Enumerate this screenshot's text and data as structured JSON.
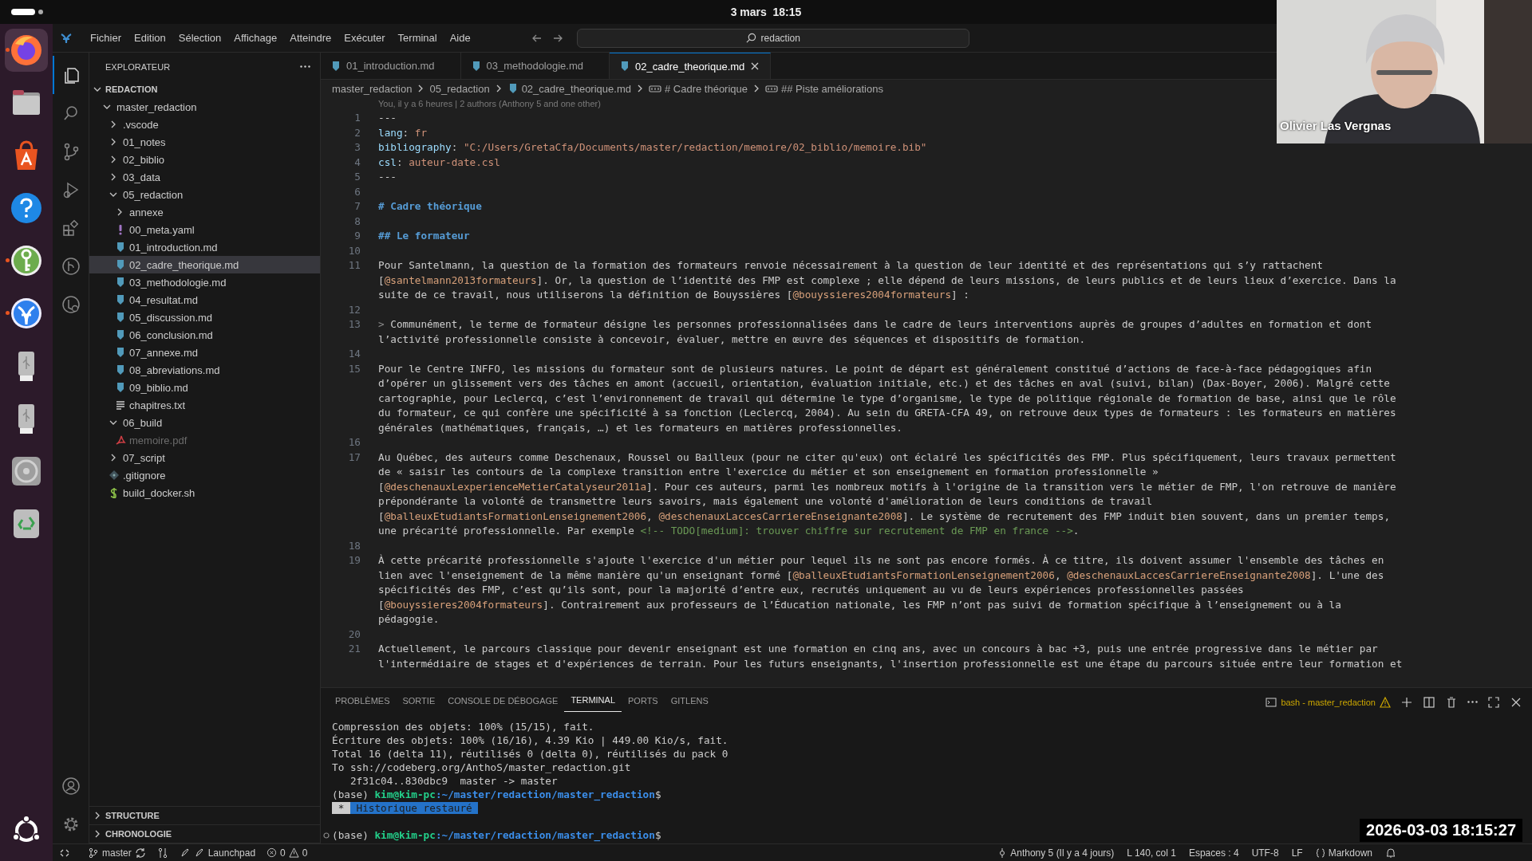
{
  "top_bar": {
    "clock": "3 mars  18:15"
  },
  "dock": [
    {
      "kind": "firefox",
      "running": true,
      "focused": true
    },
    {
      "kind": "files",
      "running": false,
      "focused": false
    },
    {
      "kind": "app-center",
      "running": false,
      "focused": false
    },
    {
      "kind": "help",
      "running": false,
      "focused": false
    },
    {
      "kind": "keepass",
      "running": true,
      "focused": false
    },
    {
      "kind": "vscodium",
      "running": true,
      "focused": false
    },
    {
      "kind": "usb",
      "running": false,
      "focused": false
    },
    {
      "kind": "usb",
      "running": false,
      "focused": false
    },
    {
      "kind": "disc",
      "running": false,
      "focused": false
    },
    {
      "kind": "trash",
      "running": false,
      "focused": false
    }
  ],
  "menu": [
    "Fichier",
    "Edition",
    "Sélection",
    "Affichage",
    "Atteindre",
    "Exécuter",
    "Terminal",
    "Aide"
  ],
  "command_center": {
    "text": "redaction"
  },
  "activity_bar": [
    {
      "kind": "explorer",
      "selected": true
    },
    {
      "kind": "search",
      "selected": false
    },
    {
      "kind": "source-control",
      "selected": false
    },
    {
      "kind": "run",
      "selected": false
    },
    {
      "kind": "extensions",
      "selected": false
    },
    {
      "kind": "gitlens",
      "selected": false
    },
    {
      "kind": "remote",
      "selected": false
    }
  ],
  "explorer": {
    "title": "EXPLORATEUR",
    "section": {
      "label": "REDACTION",
      "expanded": true
    },
    "tree": [
      {
        "kind": "folder",
        "name": "master_redaction",
        "expanded": true,
        "selected": false,
        "ignored": false,
        "children": [
          {
            "kind": "folder",
            "name": ".vscode",
            "expanded": false,
            "selected": false,
            "ignored": false
          },
          {
            "kind": "folder",
            "name": "01_notes",
            "expanded": false,
            "selected": false,
            "ignored": false
          },
          {
            "kind": "folder",
            "name": "02_biblio",
            "expanded": false,
            "selected": false,
            "ignored": false
          },
          {
            "kind": "folder",
            "name": "03_data",
            "expanded": false,
            "selected": false,
            "ignored": false
          },
          {
            "kind": "folder",
            "name": "05_redaction",
            "expanded": true,
            "selected": false,
            "ignored": false,
            "children": [
              {
                "kind": "folder",
                "name": "annexe",
                "expanded": false,
                "selected": false,
                "ignored": false
              },
              {
                "kind": "yaml",
                "name": "00_meta.yaml",
                "selected": false,
                "ignored": false
              },
              {
                "kind": "md",
                "name": "01_introduction.md",
                "selected": false,
                "ignored": false
              },
              {
                "kind": "md",
                "name": "02_cadre_theorique.md",
                "selected": true,
                "ignored": false
              },
              {
                "kind": "md",
                "name": "03_methodologie.md",
                "selected": false,
                "ignored": false
              },
              {
                "kind": "md",
                "name": "04_resultat.md",
                "selected": false,
                "ignored": false
              },
              {
                "kind": "md",
                "name": "05_discussion.md",
                "selected": false,
                "ignored": false
              },
              {
                "kind": "md",
                "name": "06_conclusion.md",
                "selected": false,
                "ignored": false
              },
              {
                "kind": "md",
                "name": "07_annexe.md",
                "selected": false,
                "ignored": false
              },
              {
                "kind": "md",
                "name": "08_abreviations.md",
                "selected": false,
                "ignored": false
              },
              {
                "kind": "md",
                "name": "09_biblio.md",
                "selected": false,
                "ignored": false
              },
              {
                "kind": "txt",
                "name": "chapitres.txt",
                "selected": false,
                "ignored": false
              }
            ]
          },
          {
            "kind": "folder",
            "name": "06_build",
            "expanded": true,
            "selected": false,
            "ignored": false,
            "children": [
              {
                "kind": "pdf",
                "name": "memoire.pdf",
                "selected": false,
                "ignored": true
              }
            ]
          },
          {
            "kind": "folder",
            "name": "07_script",
            "expanded": false,
            "selected": false,
            "ignored": false
          },
          {
            "kind": "git",
            "name": ".gitignore",
            "selected": false,
            "ignored": false
          },
          {
            "kind": "sh",
            "name": "build_docker.sh",
            "selected": false,
            "ignored": false
          }
        ]
      }
    ],
    "bottom_sections": [
      {
        "label": "STRUCTURE",
        "expanded": false
      },
      {
        "label": "CHRONOLOGIE",
        "expanded": false
      }
    ]
  },
  "tabs": [
    {
      "label": "01_introduction.md",
      "selected": false
    },
    {
      "label": "03_methodologie.md",
      "selected": false
    },
    {
      "label": "02_cadre_theorique.md",
      "selected": true
    }
  ],
  "breadcrumb": [
    {
      "kind": "folder",
      "text": "master_redaction"
    },
    {
      "kind": "folder",
      "text": "05_redaction"
    },
    {
      "kind": "file",
      "text": "02_cadre_theorique.md"
    },
    {
      "kind": "heading",
      "text": "# Cadre théorique"
    },
    {
      "kind": "heading",
      "text": "## Piste améliorations"
    }
  ],
  "editor": {
    "blame": "You, il y a 6 heures | 2 authors (Anthony 5 and one other)",
    "lines": [
      {
        "number": "1",
        "rows": [
          "---"
        ]
      },
      {
        "number": "2",
        "rows": [
          [
            {
              "kind": "key",
              "text": "lang"
            },
            {
              "kind": "text",
              "text": ": "
            },
            {
              "kind": "string",
              "text": "fr"
            }
          ]
        ]
      },
      {
        "number": "3",
        "rows": [
          [
            {
              "kind": "key",
              "text": "bibliography"
            },
            {
              "kind": "text",
              "text": ": "
            },
            {
              "kind": "string",
              "text": "\"C:/Users/GretaCfa/Documents/master/redaction/memoire/02_biblio/memoire.bib\""
            }
          ]
        ]
      },
      {
        "number": "4",
        "rows": [
          [
            {
              "kind": "key",
              "text": "csl"
            },
            {
              "kind": "text",
              "text": ": "
            },
            {
              "kind": "string",
              "text": "auteur-date.csl"
            }
          ]
        ]
      },
      {
        "number": "5",
        "rows": [
          "---"
        ]
      },
      {
        "number": "6"
      },
      {
        "number": "7",
        "rows": [
          [
            {
              "kind": "heading",
              "text": "# Cadre théorique"
            }
          ]
        ]
      },
      {
        "number": "8"
      },
      {
        "number": "9",
        "rows": [
          [
            {
              "kind": "heading",
              "text": "## Le formateur"
            }
          ]
        ]
      },
      {
        "number": "10"
      },
      {
        "number": "11",
        "rows": [
          "Pour Santelmann, la question de la formation des formateurs renvoie nécessairement à la question de leur identité et des représentations qui s’y rattachent",
          [
            {
              "kind": "text",
              "text": "["
            },
            {
              "kind": "cite",
              "text": "@santelmann2013formateurs"
            },
            {
              "kind": "text",
              "text": "]. Or, la question de l’identité des FMP est complexe ; elle dépend de leurs missions, de leurs publics et de leurs lieux d’exercice. Dans la"
            }
          ],
          [
            {
              "kind": "text",
              "text": "suite de ce travail, nous utiliserons la définition de Bouyssières ["
            },
            {
              "kind": "cite",
              "text": "@bouyssieres2004formateurs"
            },
            {
              "kind": "text",
              "text": "] :"
            }
          ]
        ]
      },
      {
        "number": "12"
      },
      {
        "number": "13",
        "rows": [
          [
            {
              "kind": "quote",
              "text": ">"
            },
            {
              "kind": "text",
              "text": " Communément, le terme de formateur désigne les personnes professionnalisées dans le cadre de leurs interventions auprès de groupes d’adultes en formation et dont"
            }
          ],
          "l’activité professionnelle consiste à concevoir, évaluer, mettre en œuvre des séquences et dispositifs de formation."
        ]
      },
      {
        "number": "14"
      },
      {
        "number": "15",
        "rows": [
          "Pour le Centre INFFO, les missions du formateur sont de plusieurs natures. Le point de départ est généralement constitué d’actions de face-à-face pédagogiques afin",
          "d’opérer un glissement vers des tâches en amont (accueil, orientation, évaluation initiale, etc.) et des tâches en aval (suivi, bilan) (Dax-Boyer, 2006). Malgré cette",
          "cartographie, pour Leclercq, c’est l’environnement de travail qui détermine le type d’organisme, le type de politique régionale de formation de base, ainsi que le rôle",
          "du formateur, ce qui confère une spécificité à sa fonction (Leclercq, 2004). Au sein du GRETA-CFA 49, on retrouve deux types de formateurs : les formateurs en matières",
          "générales (mathématiques, français, …) et les formateurs en matières professionnelles."
        ]
      },
      {
        "number": "16"
      },
      {
        "number": "17",
        "rows": [
          "Au Québec, des auteurs comme Deschenaux, Roussel ou Bailleux (pour ne citer qu'eux) ont éclairé les spécificités des FMP. Plus spécifiquement, leurs travaux permettent",
          "de « saisir les contours de la complexe transition entre l'exercice du métier et son enseignement en formation professionnelle »",
          [
            {
              "kind": "text",
              "text": "["
            },
            {
              "kind": "cite",
              "text": "@deschenauxLexperienceMetierCatalyseur2011a"
            },
            {
              "kind": "text",
              "text": "]. Pour ces auteurs, parmi les nombreux motifs à l'origine de la transition vers le métier de FMP, l'on retrouve de manière"
            }
          ],
          "prépondérante la volonté de transmettre leurs savoirs, mais également une volonté d'amélioration de leurs conditions de travail",
          [
            {
              "kind": "text",
              "text": "["
            },
            {
              "kind": "cite",
              "text": "@balleuxEtudiantsFormationLenseignement2006"
            },
            {
              "kind": "text",
              "text": ", "
            },
            {
              "kind": "cite",
              "text": "@deschenauxLaccesCarriereEnseignante2008"
            },
            {
              "kind": "text",
              "text": "]. Le système de recrutement des FMP induit bien souvent, dans un premier temps,"
            }
          ],
          [
            {
              "kind": "text",
              "text": "une précarité professionnelle. Par exemple "
            },
            {
              "kind": "comment",
              "text": "<!-- TODO[medium]: trouver chiffre sur recrutement de FMP en france -->"
            },
            {
              "kind": "text",
              "text": "."
            }
          ]
        ]
      },
      {
        "number": "18"
      },
      {
        "number": "19",
        "rows": [
          "À cette précarité professionnelle s'ajoute l'exercice d'un métier pour lequel ils ne sont pas encore formés. À ce titre, ils doivent assumer l'ensemble des tâches en",
          [
            {
              "kind": "text",
              "text": "lien avec l'enseignement de la même manière qu'un enseignant formé ["
            },
            {
              "kind": "cite",
              "text": "@balleuxEtudiantsFormationLenseignement2006"
            },
            {
              "kind": "text",
              "text": ", "
            },
            {
              "kind": "cite",
              "text": "@deschenauxLaccesCarriereEnseignante2008"
            },
            {
              "kind": "text",
              "text": "]. L'une des"
            }
          ],
          "spécificités des FMP, c’est qu’ils sont, pour la majorité d’entre eux, recrutés uniquement au vu de leurs expériences professionnelles passées",
          [
            {
              "kind": "text",
              "text": "["
            },
            {
              "kind": "cite",
              "text": "@bouyssieres2004formateurs"
            },
            {
              "kind": "text",
              "text": "]. Contrairement aux professeurs de l’Éducation nationale, les FMP n’ont pas suivi de formation spécifique à l’enseignement ou à la"
            }
          ],
          "pédagogie."
        ]
      },
      {
        "number": "20"
      },
      {
        "number": "21",
        "rows": [
          "Actuellement, le parcours classique pour devenir enseignant est une formation en cinq ans, avec un concours à bac +3, puis une entrée progressive dans le métier par",
          "l'intermédiaire de stages et d'expériences de terrain. Pour les futurs enseignants, l'insertion professionnelle est une étape du parcours située entre leur formation et"
        ]
      }
    ]
  },
  "panel": {
    "tabs": [
      {
        "label": "PROBLÈMES",
        "selected": false
      },
      {
        "label": "SORTIE",
        "selected": false
      },
      {
        "label": "CONSOLE DE DÉBOGAGE",
        "selected": false
      },
      {
        "label": "TERMINAL",
        "selected": true
      },
      {
        "label": "PORTS",
        "selected": false
      },
      {
        "label": "GITLENS",
        "selected": false
      }
    ],
    "terminal_name": "bash - master_redaction",
    "lines": [
      {
        "marker": false,
        "segments": [
          {
            "kind": "text",
            "text": "Compression des objets: 100% (15/15), fait."
          }
        ]
      },
      {
        "marker": false,
        "segments": [
          {
            "kind": "text",
            "text": "Écriture des objets: 100% (16/16), 4.39 Kio | 449.00 Kio/s, fait."
          }
        ]
      },
      {
        "marker": false,
        "segments": [
          {
            "kind": "text",
            "text": "Total 16 (delta 11), réutilisés 0 (delta 0), réutilisés du pack 0"
          }
        ]
      },
      {
        "marker": false,
        "segments": [
          {
            "kind": "text",
            "text": "To ssh://codeberg.org/AnthoS/master_redaction.git"
          }
        ]
      },
      {
        "marker": false,
        "segments": [
          {
            "kind": "text",
            "text": "   2f31c04..830dbc9  master -> master"
          }
        ]
      },
      {
        "marker": false,
        "segments": [
          {
            "kind": "text",
            "text": "(base) "
          },
          {
            "kind": "user",
            "text": "kim@kim-pc"
          },
          {
            "kind": "path",
            "text": ":~/master/redaction/master_redaction"
          },
          {
            "kind": "text",
            "text": "$"
          }
        ]
      },
      {
        "marker": false,
        "segments": [
          {
            "kind": "badge",
            "text": " * "
          },
          {
            "kind": "notice",
            "text": " Historique restauré "
          }
        ]
      },
      {
        "marker": true,
        "segments": [
          {
            "kind": "text",
            "text": "(base) "
          },
          {
            "kind": "user",
            "text": "kim@kim-pc"
          },
          {
            "kind": "path",
            "text": ":~/master/redaction/master_redaction"
          },
          {
            "kind": "text",
            "text": "$"
          }
        ]
      }
    ]
  },
  "status_bar": {
    "branch": "master",
    "launchpad": "Launchpad",
    "errors": "0",
    "warnings": "0",
    "blame": "Anthony 5 (Il y a 4 jours)",
    "position": "L 140, col 1",
    "indent": "Espaces : 4",
    "encoding": "UTF-8",
    "eol": "LF",
    "language": "Markdown"
  },
  "webcam": {
    "name": "Olivier Las Vergnas"
  },
  "recording_stamp": "2026-03-03 18:15:27"
}
